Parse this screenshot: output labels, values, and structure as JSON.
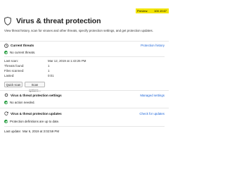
{
  "preview": {
    "label": "Preview:",
    "version": "100.19.67"
  },
  "header": {
    "title": "Virus & threat protection",
    "description": "View threat history, scan for viruses and other threats, specify protection settings, and get protection updates."
  },
  "current_threats": {
    "title": "Current threats",
    "link": "Protection history",
    "status": "No current threats.",
    "rows": [
      {
        "label": "Last scan:",
        "value": "Mar 12, 2019 at 1:43:25 PM"
      },
      {
        "label": "Threats found:",
        "value": "1"
      },
      {
        "label": "Files scanned:",
        "value": "1"
      },
      {
        "label": "Lasted:",
        "value": "0:01"
      }
    ],
    "buttons": {
      "quick_scan": "Quick scan",
      "scan_options": "Scan options..."
    }
  },
  "settings": {
    "title": "Virus & threat protection settings",
    "link": "Managed settings",
    "status": "No action needed."
  },
  "updates": {
    "title": "Virus & threat protection updates",
    "link": "Check for updates",
    "status": "Protection definitions are up to date.",
    "last_update_label": "Last update:",
    "last_update_value": "Mar 6, 2019 at 3:02:59 PM"
  },
  "colors": {
    "accent_link": "#1a63d8",
    "ok_green": "#1f9a3a",
    "preview_yellow": "#f2e400"
  }
}
